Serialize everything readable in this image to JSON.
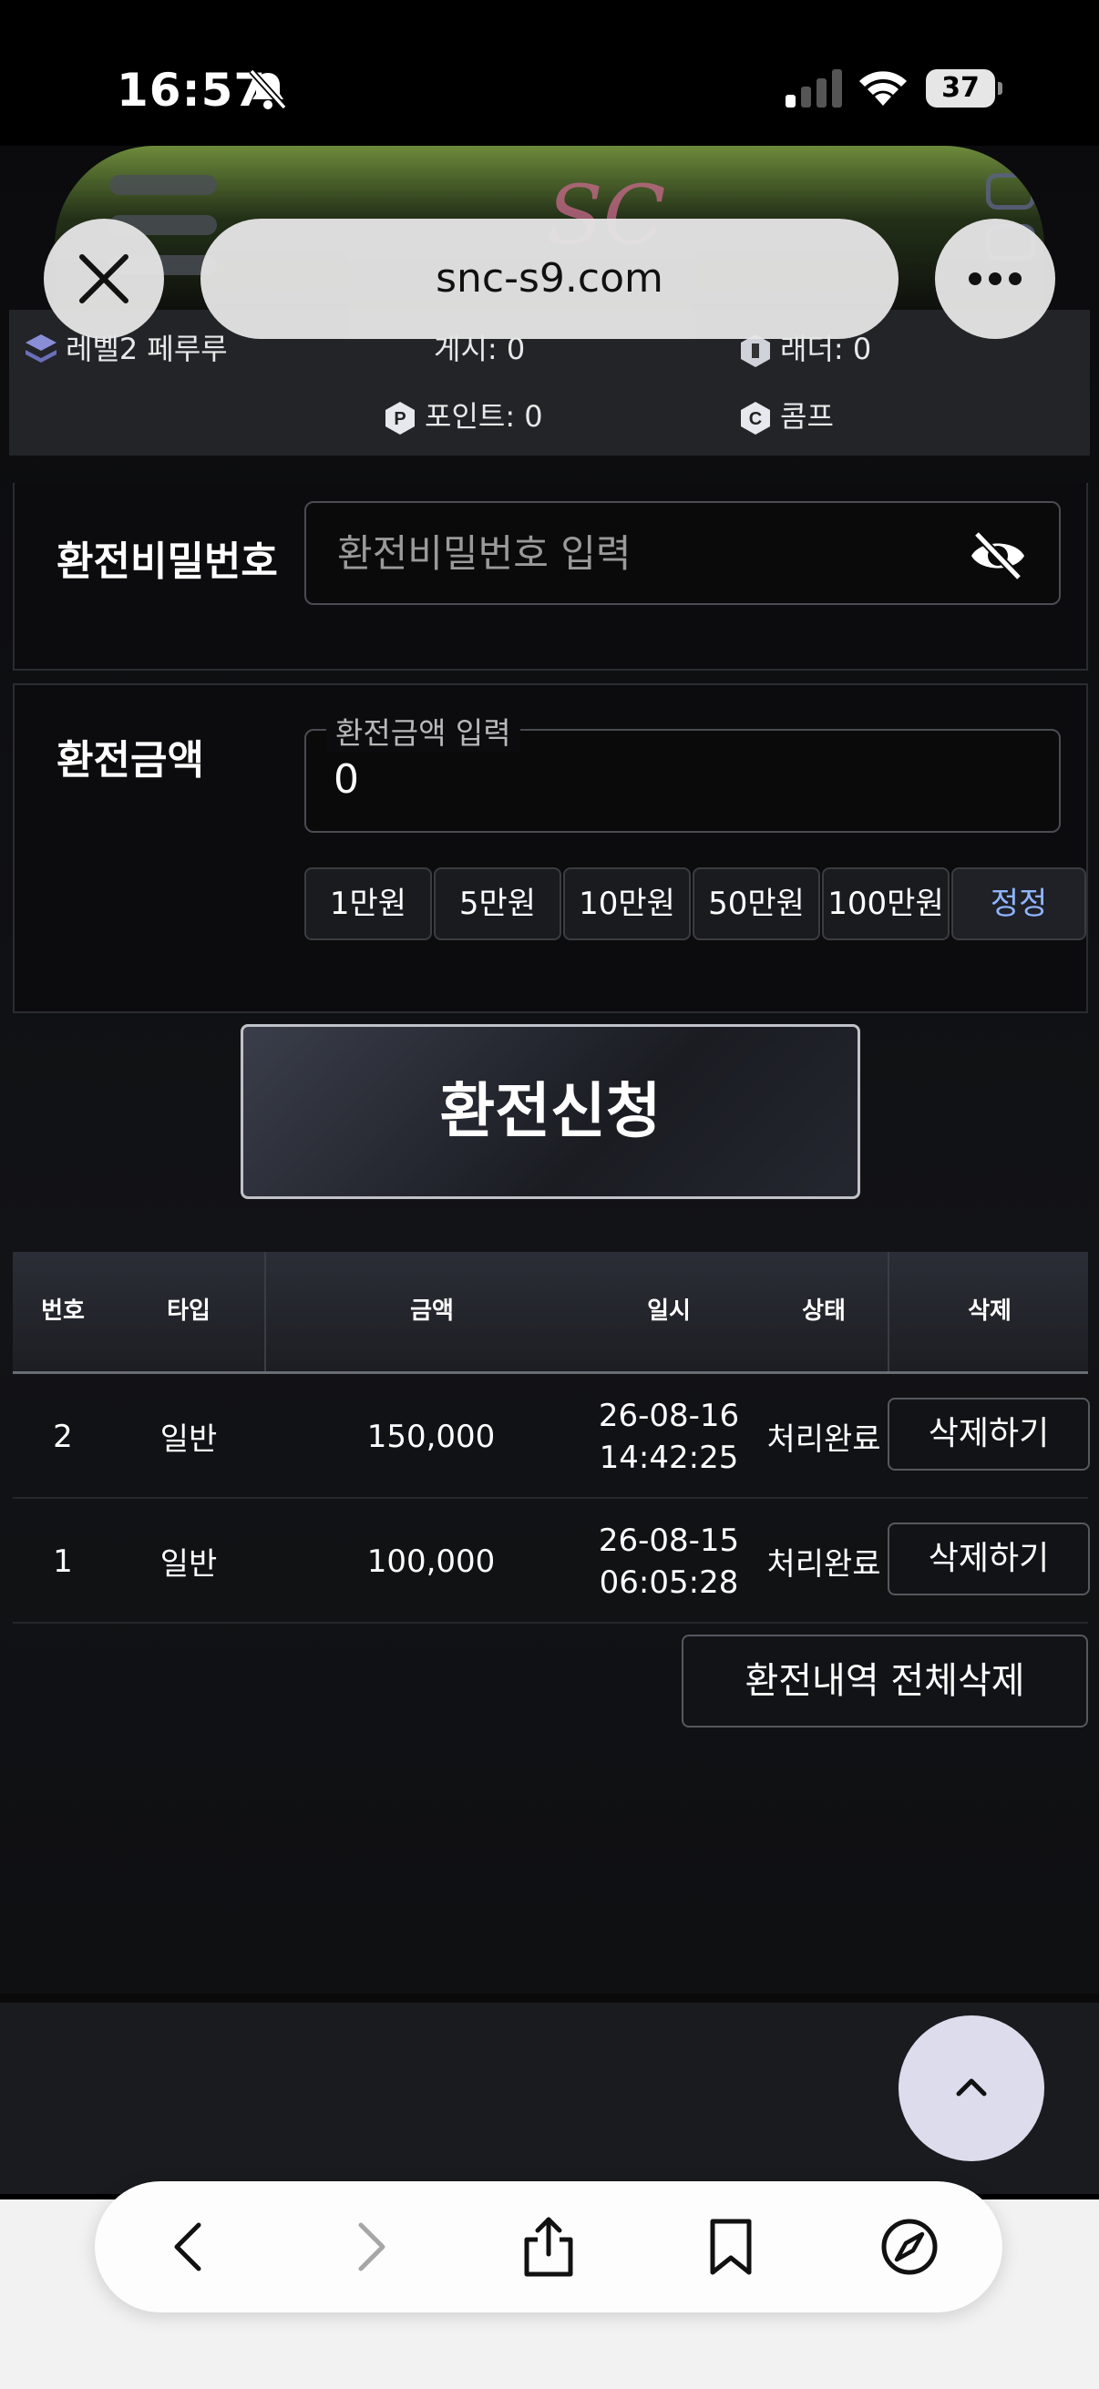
{
  "status_bar": {
    "time": "16:57",
    "battery": "37"
  },
  "browser": {
    "url": "snc-s9.com"
  },
  "site": {
    "logo": "SC"
  },
  "userbar": {
    "level": "레벨2 페루루",
    "money": "게시: 0",
    "ladder": "래더: 0",
    "points": "포인트: 0",
    "comp": "콤프"
  },
  "form": {
    "password_label": "환전비밀번호",
    "password_placeholder": "환전비밀번호 입력",
    "amount_label": "환전금액",
    "amount_legend": "환전금액 입력",
    "amount_value": "0",
    "quick_buttons": [
      "1만원",
      "5만원",
      "10만원",
      "50만원",
      "100만원"
    ],
    "reset_label": "정정",
    "submit_label": "환전신청"
  },
  "table": {
    "headers": [
      "번호",
      "타입",
      "금액",
      "일시",
      "상태",
      "삭제"
    ],
    "rows": [
      {
        "no": "2",
        "type": "일반",
        "amount": "150,000",
        "date": "26-08-16",
        "time": "14:42:25",
        "status": "처리완료",
        "action": "삭제하기"
      },
      {
        "no": "1",
        "type": "일반",
        "amount": "100,000",
        "date": "26-08-15",
        "time": "06:05:28",
        "status": "처리완료",
        "action": "삭제하기"
      }
    ]
  },
  "delete_all_label": "환전내역 전체삭제",
  "icons": {
    "close": "close-icon",
    "more": "more-icon",
    "scroll_top": "chevron-up-icon",
    "back": "back-icon",
    "forward": "forward-icon",
    "share": "share-icon",
    "bookmarks": "bookmarks-icon",
    "compass": "compass-icon"
  }
}
